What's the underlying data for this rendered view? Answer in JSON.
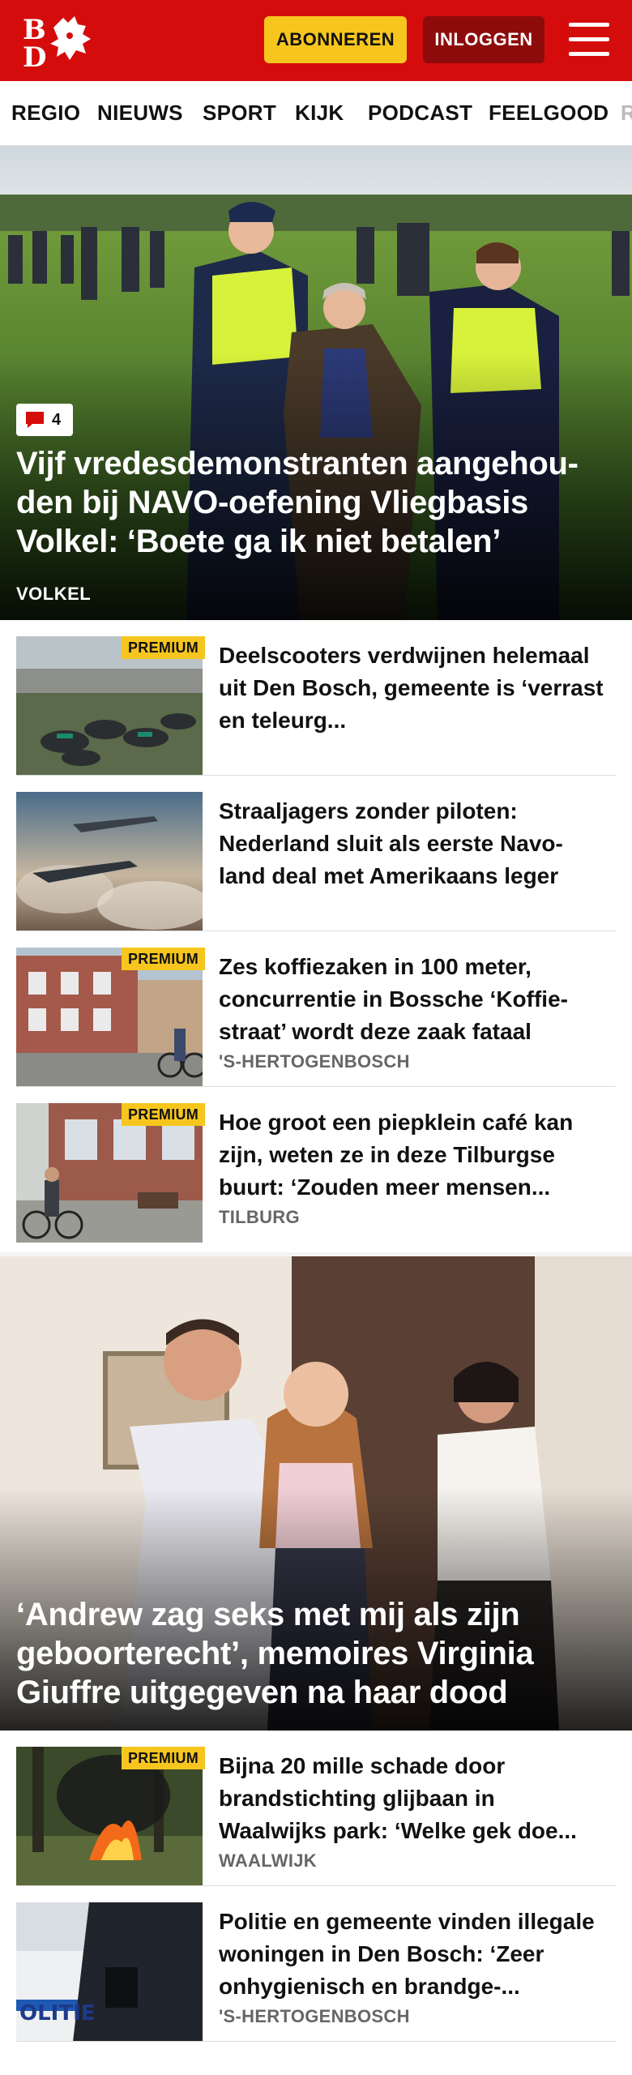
{
  "header": {
    "logo_text": "BD",
    "subscribe_label": "ABONNEREN",
    "login_label": "INLOGGEN"
  },
  "nav": [
    "REGIO",
    "NIEUWS",
    "SPORT",
    "KIJK",
    "PODCAST",
    "FEELGOOD",
    "R"
  ],
  "hero": {
    "comments": "4",
    "title": "Vijf vredesdemonstranten aangehou-den bij NAVO-oefening Vliegbasis Volkel: ‘Boete ga ik niet betalen’",
    "location": "VOLKEL"
  },
  "articles": [
    {
      "premium": "PREMIUM",
      "title": "Deelscooters verdwijnen helemaal uit Den Bosch, gemeente is ‘verrast en teleurg...",
      "location": ""
    },
    {
      "premium": "",
      "title": "Straaljagers zonder piloten: Nederland sluit als eerste Navo-land deal met Amerikaans leger",
      "location": ""
    },
    {
      "premium": "PREMIUM",
      "title": "Zes koffiezaken in 100 meter, concurrentie in Bossche ‘Koffie-straat’ wordt deze zaak fataal",
      "location": "'S-HERTOGENBOSCH"
    },
    {
      "premium": "PREMIUM",
      "title": "Hoe groot een piepklein café kan zijn, weten ze in deze Tilburgse buurt: ‘Zouden meer mensen...",
      "location": "TILBURG"
    }
  ],
  "hero2": {
    "title": "‘Andrew zag seks met mij als zijn geboorterecht’, memoires Virginia Giuffre uitgegeven na haar dood"
  },
  "articles2": [
    {
      "premium": "PREMIUM",
      "title": "Bijna 20 mille schade door brandstichting glijbaan in Waalwijks park: ‘Welke gek doe...",
      "location": "WAALWIJK"
    },
    {
      "premium": "",
      "title": "Politie en gemeente vinden illegale woningen in Den Bosch: ‘Zeer onhygienisch en brandge-...",
      "location": "'S-HERTOGENBOSCH",
      "thumb_text": "OLITIE"
    }
  ],
  "colors": {
    "brand_red": "#d50c0c",
    "premium_yellow": "#f7c61e",
    "login_dark": "#8e0b0b"
  }
}
